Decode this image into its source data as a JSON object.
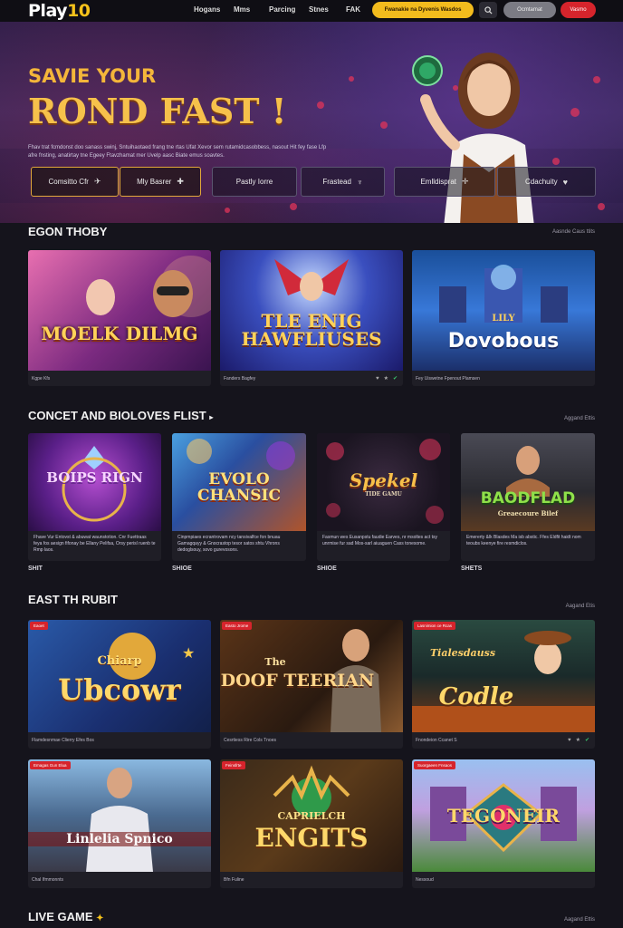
{
  "nav": {
    "logo_a": "Play",
    "logo_b": "10",
    "links": [
      "Hogans",
      "Mms",
      "Parcing",
      "Stnes",
      "FAK"
    ],
    "promo": "Fwanakie na Dyvenis Wasdos",
    "btn_grey": "Ocmtamat",
    "btn_red": "Vasmo"
  },
  "hero": {
    "kicker": "SAVIE YOUR",
    "title": "ROND FAST !",
    "desc": "Fhav trat fcmdonst doo sanass swinj, Sntuihaotaed frang tne rtas Ufat Xevor sem rutamidcasobbess, nasout Hit fey fase Lfp afre fnsting, anatirtay tne Egeey Ftavzhamat mer Uvelp aasc Biate emus soavtes.",
    "buttons": [
      {
        "label": "Comsitto Cfr",
        "icon": "✈"
      },
      {
        "label": "Mly Basrer",
        "icon": "✚"
      },
      {
        "label": "Pastly Iorre",
        "icon": ""
      },
      {
        "label": "Frastead",
        "icon": "♆"
      },
      {
        "label": "Emlldisprat",
        "icon": "✛"
      },
      {
        "label": "Cdachuity",
        "icon": "♥"
      }
    ]
  },
  "sections": {
    "s1": {
      "title": "EGON THOBY",
      "link": "Aasnde Caus ttits"
    },
    "s2": {
      "title": "CONCET AND BIOLOVES FLIST",
      "link": "Aggand Ettis"
    },
    "s3": {
      "title": "EAST TH RUBIT",
      "link": "Aagand Etis"
    },
    "s4": {
      "title": "LIVE GAME",
      "link": "Aagand Ettis"
    }
  },
  "row1": [
    {
      "title": "MOELK DILMG",
      "meta": "Kgpe Kfs"
    },
    {
      "title": "TLE ENIG HAWFLIUSES",
      "meta": "Fanders Bagfey"
    },
    {
      "title": "Dovobous",
      "pre": "LILY",
      "meta": "Fey Uiswetne Fpenout Plamsen"
    }
  ],
  "row2": [
    {
      "title": "BOIPS RIGN",
      "desc": "Fhave Vur Entovst & abuwat waunstotion. Cnr Fuettraas feya fos aesign fifonay be Ellany Pelifsa, Orsy perisl ruenb te Rmp laos.",
      "under": "SHIT"
    },
    {
      "title": "EVOLO CHANSIC",
      "desc": "Cinpmpiaes ecrantrovam ncy tansivalfce fon bnuau Gamagqayy & Gnocrastop tesor satos shtu Vhrons dedoglsouy, sovo gurevosons.",
      "under": "SHIOE"
    },
    {
      "title": "Spekel",
      "sub": "TIDE GAMU",
      "desc": "Fasmun wes Eusanpstu faudie Earves, nr msoltes act tsy unrmise fur sad Mos-sarl aiuaguen Cass tonesome.",
      "under": "SHIOE"
    },
    {
      "title": "BAODFLAD",
      "sub": "Greaecoure Bilef",
      "desc": "Emererty &lk Blasdes Ma isb abstic. Ffes Eldfit haidt nom teoubs keenye fire resmdiclos.",
      "under": "SHETS"
    }
  ],
  "row3": [
    {
      "title": "Ubcowr",
      "pre": "Chiarp",
      "tag": "Eaoet",
      "meta": "Flamdesnmae Clierry Efes Bos"
    },
    {
      "title": "IDOOF TEERIAN",
      "pre": "The",
      "tag": "Easto Jrome",
      "meta": "Cesrtiess Rire Cols Tnoes"
    },
    {
      "title": "Codle",
      "pre": "Tialesdauss",
      "tag": "Lasnimion ce Rcas",
      "meta": "Fnondeion Ccanet S"
    },
    {
      "title": "Linlelia Spnico",
      "tag": "Emagas Gun Elua",
      "meta": "Chal Ifmmonnts"
    },
    {
      "title": "ENGITS",
      "pre": "CAPRIELCH",
      "tag": "Feinsfrte",
      "meta": "Bfn Fuline"
    },
    {
      "title": "TEGONEIR",
      "tag": "Suorgaeen Fnsaos",
      "meta": "Nessoud"
    }
  ]
}
